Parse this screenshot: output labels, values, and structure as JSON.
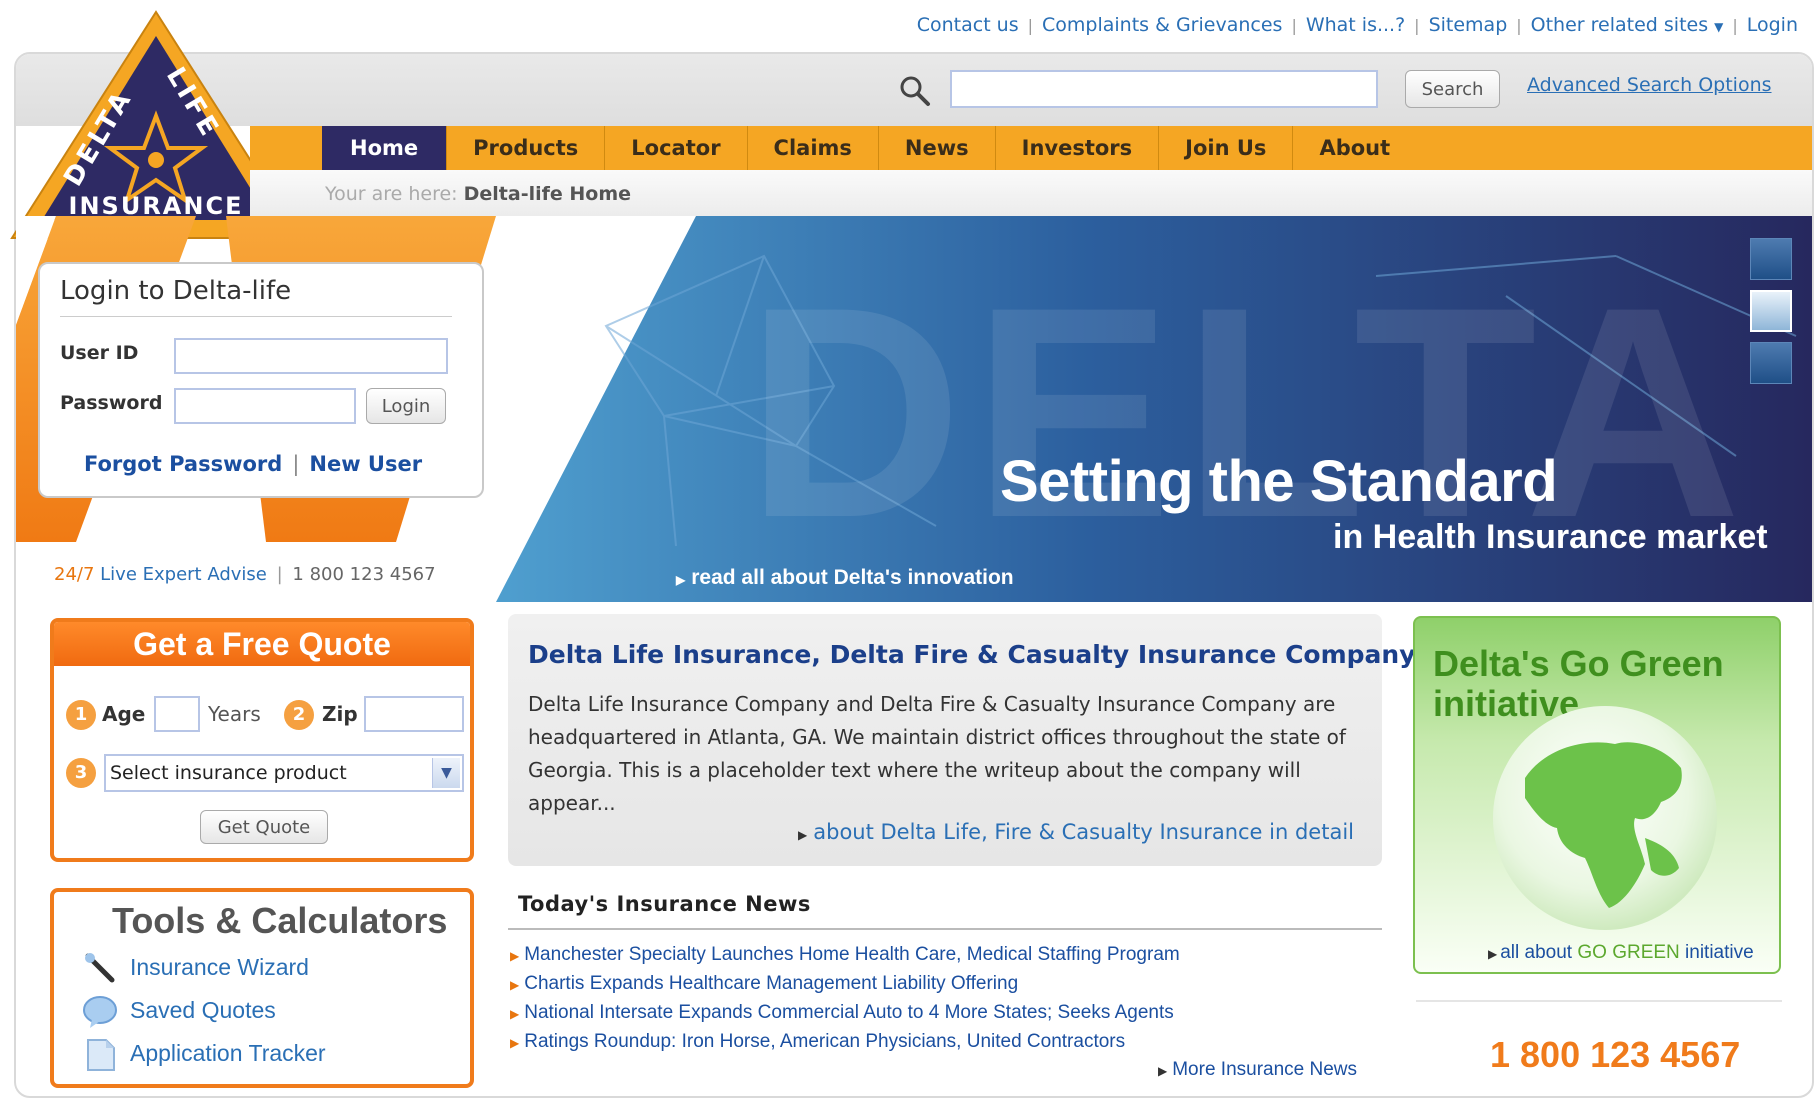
{
  "top_links": {
    "contact": "Contact us",
    "complaints": "Complaints & Grievances",
    "what_is": "What is...?",
    "sitemap": "Sitemap",
    "other_sites": "Other related sites",
    "login": "Login"
  },
  "logo": {
    "word1": "DELTA",
    "word2": "LIFE",
    "word3": "INSURANCE"
  },
  "search": {
    "placeholder": "",
    "button": "Search",
    "advanced": "Advanced Search Options"
  },
  "nav": [
    "Home",
    "Products",
    "Locator",
    "Claims",
    "News",
    "Investors",
    "Join Us",
    "About"
  ],
  "breadcrumb": {
    "prefix": "Your are here:",
    "current": "Delta-life Home"
  },
  "hero": {
    "watermark": "DELTA",
    "title": "Setting the Standard",
    "subtitle": "in Health Insurance market",
    "link": "read all about Delta's innovation"
  },
  "login": {
    "title": "Login to Delta-life",
    "user_label": "User ID",
    "password_label": "Password",
    "button": "Login",
    "forgot": "Forgot Password",
    "new_user": "New User"
  },
  "expert": {
    "hours": "24/7",
    "label": "Live Expert Advise",
    "phone": "1 800 123 4567"
  },
  "quote": {
    "title": "Get a Free Quote",
    "step1": "1",
    "age_label": "Age",
    "age_unit": "Years",
    "step2": "2",
    "zip_label": "Zip",
    "step3": "3",
    "select_value": "Select insurance product",
    "button": "Get Quote"
  },
  "tools": {
    "title": "Tools & Calculators",
    "items": [
      "Insurance Wizard",
      "Saved Quotes",
      "Application Tracker"
    ]
  },
  "about": {
    "title": "Delta Life Insurance, Delta Fire & Casualty Insurance Company",
    "text": "Delta Life Insurance Company and Delta Fire & Casualty Insurance Company are headquartered in Atlanta, GA.   We maintain district offices throughout the state of Georgia. This is a placeholder text where the writeup about the company will appear...",
    "link": "about Delta Life, Fire & Casualty Insurance in detail"
  },
  "news": {
    "title": "Today's Insurance News",
    "items": [
      "Manchester Specialty Launches Home Health Care, Medical Staffing Program",
      "Chartis Expands Healthcare Management Liability Offering",
      "National Intersate Expands Commercial Auto to 4 More States; Seeks Agents",
      "Ratings Roundup: Iron Horse, American Physicians, United Contractors"
    ],
    "more": "More Insurance News"
  },
  "green": {
    "title": "Delta's Go Green initiative",
    "link_prefix": "all about",
    "link_highlight": "GO GREEN",
    "link_suffix": "initiative"
  },
  "phone": "1 800 123 4567",
  "colors": {
    "orange": "#f5a623",
    "navy": "#2e2a64",
    "link": "#2a6fb5",
    "green": "#3f8f1e",
    "quote_orange": "#f07b1b"
  }
}
